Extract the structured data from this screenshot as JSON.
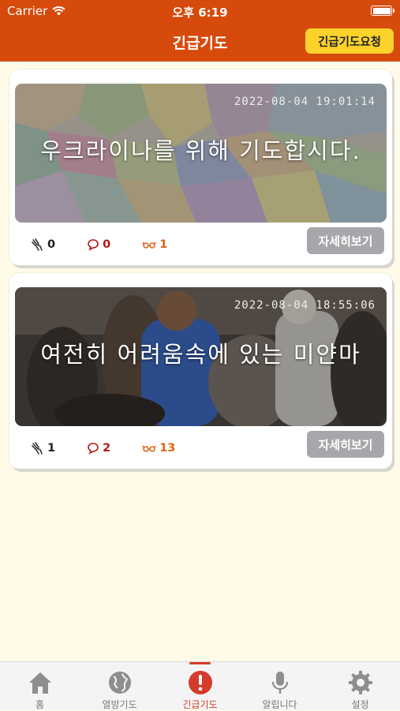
{
  "status_bar": {
    "carrier": "Carrier",
    "time": "오후 6:19"
  },
  "header": {
    "title": "긴급기도",
    "request_button": "긴급기도요청"
  },
  "cards": [
    {
      "date": "2022-08-04 19:01:14",
      "caption": "우크라이나를 위해 기도합시다.",
      "pray_count": "0",
      "comment_count": "0",
      "view_count": "1",
      "detail_button": "자세히보기"
    },
    {
      "date": "2022-08-04 18:55:06",
      "caption": "여전히 어려움속에 있는 미얀마",
      "pray_count": "1",
      "comment_count": "2",
      "view_count": "13",
      "detail_button": "자세히보기"
    }
  ],
  "tabbar": {
    "items": [
      {
        "label": "홈",
        "icon": "home-icon"
      },
      {
        "label": "열방기도",
        "icon": "globe-icon"
      },
      {
        "label": "긴급기도",
        "icon": "alert-icon",
        "active": true
      },
      {
        "label": "알립니다",
        "icon": "microphone-icon"
      },
      {
        "label": "설정",
        "icon": "gear-icon"
      }
    ]
  },
  "colors": {
    "header": "#d64a0c",
    "request_button": "#fdd32b",
    "background": "#fffbe8",
    "active_tab": "#d63a2a",
    "detail_button": "#a7a7ab"
  }
}
